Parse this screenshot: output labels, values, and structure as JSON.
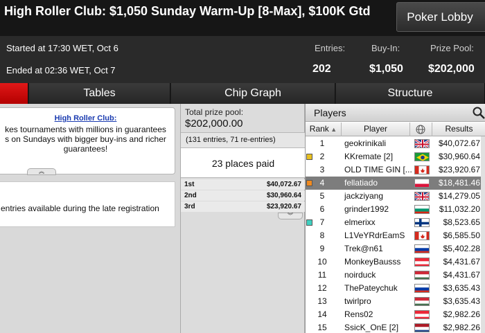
{
  "header": {
    "title": "High Roller Club: $1,050 Sunday Warm-Up [8-Max], $100K Gtd",
    "lobby_button": "Poker Lobby",
    "started": "Started at 17:30 WET, Oct 6",
    "ended": "Ended at 02:36 WET, Oct 7",
    "entries_label": "Entries:",
    "entries_value": "202",
    "buyin_label": "Buy-In:",
    "buyin_value": "$1,050",
    "prizepool_label": "Prize Pool:",
    "prizepool_value": "$202,000"
  },
  "tabs": [
    "Tables",
    "Chip Graph",
    "Structure"
  ],
  "description": {
    "title": "High Roller Club:",
    "line1": "kes tournaments with millions in guarantees",
    "line2": "s on Sundays with bigger buy-ins and richer",
    "line3": "guarantees!",
    "late_reg": "entries available during the late registration"
  },
  "prize": {
    "total_label": "Total prize pool:",
    "total_value": "$202,000.00",
    "entries_note": "(131 entries, 71 re-entries)",
    "places_paid": "23 places paid",
    "payouts": [
      {
        "place": "1st",
        "amount": "$40,072.67"
      },
      {
        "place": "2nd",
        "amount": "$30,960.64"
      },
      {
        "place": "3rd",
        "amount": "$23,920.67"
      }
    ]
  },
  "players": {
    "title": "Players",
    "columns": {
      "rank": "Rank",
      "player": "Player",
      "results": "Results"
    },
    "rows": [
      {
        "rank": "1",
        "name": "geokrinikali",
        "flag": "uk",
        "result": "$40,072.67",
        "marker": ""
      },
      {
        "rank": "2",
        "name": "KKremate [2]",
        "flag": "brazil",
        "result": "$30,960.64",
        "marker": "#e8c020"
      },
      {
        "rank": "3",
        "name": "OLD TIME GIN [...",
        "flag": "canada",
        "result": "$23,920.67",
        "marker": ""
      },
      {
        "rank": "4",
        "name": "fellatiado",
        "flag": "poland",
        "result": "$18,481.46",
        "marker": "#f08a20"
      },
      {
        "rank": "5",
        "name": "jackziyang",
        "flag": "uk",
        "result": "$14,279.05",
        "marker": ""
      },
      {
        "rank": "6",
        "name": "grinder1992",
        "flag": "bulgaria",
        "result": "$11,032.20",
        "marker": ""
      },
      {
        "rank": "7",
        "name": "elmerixx",
        "flag": "finland",
        "result": "$8,523.65",
        "marker": "#40d0c0"
      },
      {
        "rank": "8",
        "name": "L1VeYRdrEamS",
        "flag": "canada",
        "result": "$6,585.50",
        "marker": ""
      },
      {
        "rank": "9",
        "name": "Trek@n61",
        "flag": "russia",
        "result": "$5,402.28",
        "marker": ""
      },
      {
        "rank": "10",
        "name": "MonkeyBausss",
        "flag": "austria",
        "result": "$4,431.67",
        "marker": ""
      },
      {
        "rank": "11",
        "name": "noirduck",
        "flag": "hungary",
        "result": "$4,431.67",
        "marker": ""
      },
      {
        "rank": "12",
        "name": "ThePateychuk",
        "flag": "russia",
        "result": "$3,635.43",
        "marker": ""
      },
      {
        "rank": "13",
        "name": "twirlpro",
        "flag": "hungary",
        "result": "$3,635.43",
        "marker": ""
      },
      {
        "rank": "14",
        "name": "Rens02",
        "flag": "austria",
        "result": "$2,982.26",
        "marker": ""
      },
      {
        "rank": "15",
        "name": "SsicK_OnE [2]",
        "flag": "netherlands",
        "result": "$2,982.26",
        "marker": ""
      }
    ],
    "selected_rank": "4"
  },
  "colors": {
    "accent_red": "#d00000",
    "selected_row": "#7d7d7d",
    "link_blue": "#1a3bb0"
  }
}
